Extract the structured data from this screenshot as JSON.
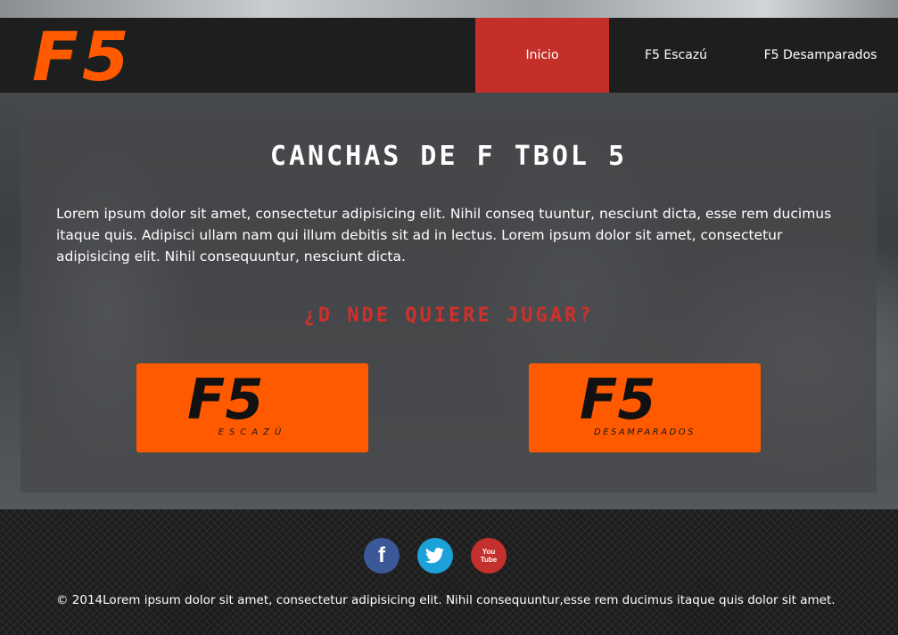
{
  "brand": {
    "logo_text": "F5",
    "orange": "#ff5a00",
    "red": "#c42f2a"
  },
  "nav": [
    {
      "label": "Inicio",
      "active": true
    },
    {
      "label": "F5 Escazú",
      "active": false
    },
    {
      "label": "F5 Desamparados",
      "active": false
    }
  ],
  "main": {
    "title": "Canchas de F tbol 5",
    "body": "Lorem ipsum dolor sit amet, consectetur adipisicing elit. Nihil conseq tuuntur, nesciunt dicta, esse rem ducimus itaque quis. Adipisci ullam nam qui illum debitis sit ad in lectus. Lorem ipsum dolor sit amet, consectetur adipisicing elit. Nihil consequuntur, nesciunt dicta.",
    "subtitle": "¿D nde quiere jugar?",
    "venues": [
      {
        "logo": "F5",
        "label": "ESCAZÚ"
      },
      {
        "logo": "F5",
        "label": "DESAMPARADOS"
      }
    ]
  },
  "footer": {
    "social": [
      {
        "icon": "facebook-icon",
        "glyph": "f"
      },
      {
        "icon": "twitter-icon",
        "glyph": "t"
      },
      {
        "icon": "youtube-icon",
        "glyph": "You Tube"
      }
    ],
    "copyright": "© 2014Lorem ipsum dolor sit amet, consectetur adipisicing elit. Nihil consequuntur,esse rem ducimus itaque quis dolor sit amet."
  }
}
